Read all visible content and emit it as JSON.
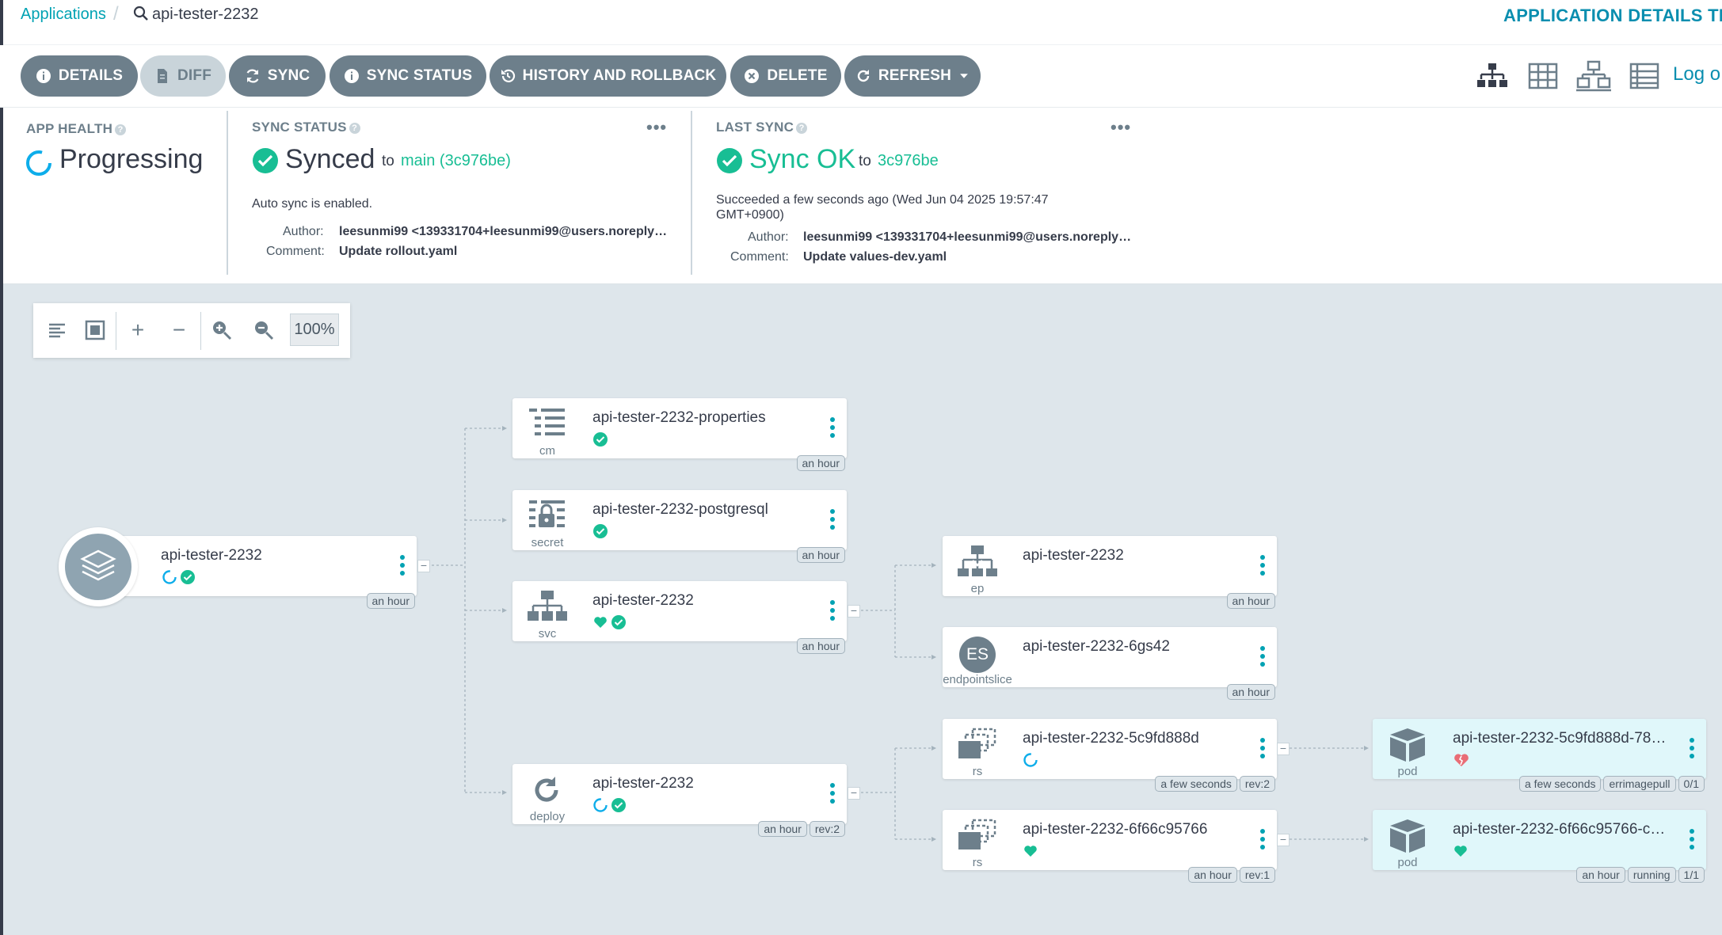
{
  "breadcrumb": {
    "root": "Applications",
    "current": "api-tester-2232"
  },
  "header_title": "APPLICATION DETAILS TRE",
  "toolbar": {
    "details": "DETAILS",
    "diff": "DIFF",
    "sync": "SYNC",
    "sync_status": "SYNC STATUS",
    "history": "HISTORY AND ROLLBACK",
    "delete": "DELETE",
    "refresh": "REFRESH",
    "logs": "Log o"
  },
  "app_health": {
    "label": "APP HEALTH",
    "value": "Progressing"
  },
  "sync_status": {
    "label": "SYNC STATUS",
    "value": "Synced",
    "to": "to",
    "revision": "main (3c976be)",
    "auto_sync": "Auto sync is enabled.",
    "author_label": "Author:",
    "author": "leesunmi99 <139331704+leesunmi99@users.noreply…",
    "comment_label": "Comment:",
    "comment": "Update rollout.yaml",
    "more": "•••"
  },
  "last_sync": {
    "label": "LAST SYNC",
    "value": "Sync OK",
    "to": "to",
    "revision": "3c976be",
    "succeeded": "Succeeded a few seconds ago (Wed Jun 04 2025 19:57:47",
    "succeeded2": "GMT+0900)",
    "author_label": "Author:",
    "author": "leesunmi99 <139331704+leesunmi99@users.noreply…",
    "comment_label": "Comment:",
    "comment": "Update values-dev.yaml",
    "more": "•••"
  },
  "zoom": {
    "value": "100%"
  },
  "colors": {
    "accent": "#00a2b3",
    "healthy": "#18be94",
    "degraded": "#e96d76",
    "progressing": "#0dadea",
    "button": "#6d7f8b"
  },
  "nodes": {
    "app": {
      "name": "api-tester-2232",
      "tag": "an hour"
    },
    "cm": {
      "name": "api-tester-2232-properties",
      "type": "cm",
      "tag": "an hour"
    },
    "secret": {
      "name": "api-tester-2232-postgresql",
      "type": "secret",
      "tag": "an hour"
    },
    "svc": {
      "name": "api-tester-2232",
      "type": "svc",
      "tag": "an hour"
    },
    "deploy": {
      "name": "api-tester-2232",
      "type": "deploy",
      "tag": "an hour",
      "rev": "rev:2"
    },
    "ep": {
      "name": "api-tester-2232",
      "type": "ep",
      "tag": "an hour"
    },
    "es": {
      "name": "api-tester-2232-6gs42",
      "type": "endpointslice",
      "badge": "ES",
      "tag": "an hour"
    },
    "rs1": {
      "name": "api-tester-2232-5c9fd888d",
      "type": "rs",
      "tag": "a few seconds",
      "rev": "rev:2"
    },
    "rs2": {
      "name": "api-tester-2232-6f66c95766",
      "type": "rs",
      "tag": "an hour",
      "rev": "rev:1"
    },
    "pod1": {
      "name": "api-tester-2232-5c9fd888d-78…",
      "type": "pod",
      "tag": "a few seconds",
      "status": "errimagepull",
      "ready": "0/1"
    },
    "pod2": {
      "name": "api-tester-2232-6f66c95766-c…",
      "type": "pod",
      "tag": "an hour",
      "status": "running",
      "ready": "1/1"
    }
  }
}
